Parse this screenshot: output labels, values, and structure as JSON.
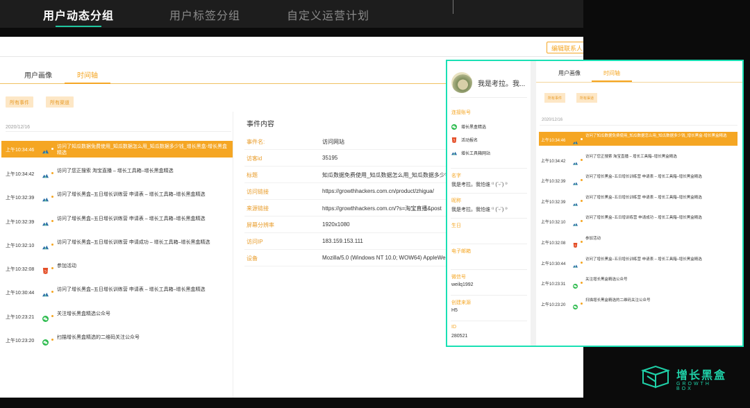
{
  "top_nav": {
    "tabs": [
      {
        "label": "用户动态分组"
      },
      {
        "label": "用户标签分组"
      },
      {
        "label": "自定义运营计划"
      }
    ],
    "accent_color": "#1fc7a0"
  },
  "main": {
    "edit_button": "编辑联系人",
    "tabs": [
      {
        "label": "用户画像"
      },
      {
        "label": "时间轴"
      }
    ],
    "filters": [
      "所有事件",
      "所有渠道"
    ],
    "date": "2020/12/16",
    "timeline": [
      {
        "time": "上午10:34:46",
        "icon": "growth-tools-icon",
        "text": "访问了知瓜数据免费使用_知瓜数据怎么用_知瓜数据多少钱_增长黑盒-增长黑盒精选"
      },
      {
        "time": "上午10:34:42",
        "icon": "growth-tools-icon",
        "text": "访问了您正搜索 淘宝直播 – 增长工具箱–增长黑盒精选"
      },
      {
        "time": "上午10:32:39",
        "icon": "growth-tools-icon",
        "text": "访问了增长黑盒–五日增长训练营 申请表 – 增长工具箱–增长黑盒精选"
      },
      {
        "time": "上午10:32:39",
        "icon": "growth-tools-icon",
        "text": "访问了增长黑盒–五日增长训练营 申请表 – 增长工具箱–增长黑盒精选"
      },
      {
        "time": "上午10:32:10",
        "icon": "growth-tools-icon",
        "text": "访问了增长黑盒–五日增长训练营 申请成功 – 增长工具箱–增长黑盒精选"
      },
      {
        "time": "上午10:32:08",
        "icon": "html5-icon",
        "text": "参加活动"
      },
      {
        "time": "上午10:30:44",
        "icon": "growth-tools-icon",
        "text": "访问了增长黑盒–五日增长训练营 申请表 – 增长工具箱–增长黑盒精选"
      },
      {
        "time": "上午10:23:21",
        "icon": "wechat-icon",
        "text": "关注增长黑盒精选公众号"
      },
      {
        "time": "上午10:23:20",
        "icon": "wechat-icon",
        "text": "扫描增长黑盒精选的二维码关注公众号"
      }
    ],
    "event": {
      "title": "事件内容",
      "rows": [
        {
          "key": "事件名:",
          "value": "访问网站"
        },
        {
          "key": "访客id",
          "value": "35195"
        },
        {
          "key": "标题",
          "value": "知瓜数据免费使用_知瓜数据怎么用_知瓜数据多少钱_增长黑"
        },
        {
          "key": "访问链接",
          "value": "https://growthhackers.com.cn/product/zhigua/"
        },
        {
          "key": "来源链接",
          "value": "https://growthhackers.com.cn/?s=淘宝直播&post"
        },
        {
          "key": "屏幕分辨率",
          "value": "1920x1080"
        },
        {
          "key": "访问IP",
          "value": "183.159.153.111"
        },
        {
          "key": "设备",
          "value": "Mozilla/5.0 (Windows NT 10.0; WOW64) AppleWe"
        }
      ]
    }
  },
  "overlay": {
    "profile": {
      "name": "我是考拉。我...",
      "linked_title": "连接账号",
      "linked": [
        {
          "icon": "wechat-icon",
          "label": "增长黑盒精选"
        },
        {
          "icon": "html5-icon",
          "label": "活动报名"
        },
        {
          "icon": "growth-tools-icon",
          "label": "增长工具箱网站"
        }
      ],
      "fields": [
        {
          "label": "名字",
          "value": "我是考拉。我怕谁 ⁽⁽ (ˊᵕˋ) ⁾⁾"
        },
        {
          "label": "昵称",
          "value": "我是考拉。我怕谁 ⁽⁽ (ˊᵕˋ) ⁾⁾"
        },
        {
          "label": "生日",
          "value": ""
        },
        {
          "label": "电子邮箱",
          "value": ""
        },
        {
          "label": "微信号",
          "value": "weilq1992"
        },
        {
          "label": "创建来源",
          "value": "H5"
        },
        {
          "label": "ID",
          "value": "280521"
        }
      ]
    },
    "tabs": [
      {
        "label": "用户画像"
      },
      {
        "label": "时间轴"
      }
    ],
    "filters": [
      "所有事件",
      "所有渠道"
    ],
    "date": "2020/12/16",
    "timeline": [
      {
        "time": "上午10:34:46",
        "icon": "growth-tools-icon",
        "text": "访问了知瓜数据免费使用_知瓜数据怎么用_知瓜数据多少钱_增长黑盒-增长黑盒精选"
      },
      {
        "time": "上午10:34:42",
        "icon": "growth-tools-icon",
        "text": "访问了您正搜索 淘宝直播 – 增长工具箱–增长黑盒精选"
      },
      {
        "time": "上午10:32:39",
        "icon": "growth-tools-icon",
        "text": "访问了增长黑盒–五日增长训练营 申请表 – 增长工具箱–增长黑盒精选"
      },
      {
        "time": "上午10:32:39",
        "icon": "growth-tools-icon",
        "text": "访问了增长黑盒–五日增长训练营 申请表 – 增长工具箱–增长黑盒精选"
      },
      {
        "time": "上午10:32:10",
        "icon": "growth-tools-icon",
        "text": "访问了增长黑盒–五日增训练营 申请成功 – 增长工具箱–增长黑盒精选"
      },
      {
        "time": "上午10:32:08",
        "icon": "html5-icon",
        "text": "参加活动"
      },
      {
        "time": "上午10:30:44",
        "icon": "growth-tools-icon",
        "text": "访问了增长黑盒–五日增长训练营 申请表 – 增长工具箱–增长黑盒精选"
      },
      {
        "time": "上午10:23:31",
        "icon": "wechat-icon",
        "text": "关注增长黑盒精选公众号"
      },
      {
        "time": "上午10:23:20",
        "icon": "wechat-icon",
        "text": "扫描增长黑盒精选的二维码关注公众号"
      }
    ],
    "border_color": "#19e0b4"
  },
  "brand": {
    "name": "增长黑盒",
    "sub": "GROWTH BOX",
    "color": "#1fd1a8"
  },
  "colors": {
    "accent": "#f5a623",
    "filter_bg": "#fde7c6"
  }
}
